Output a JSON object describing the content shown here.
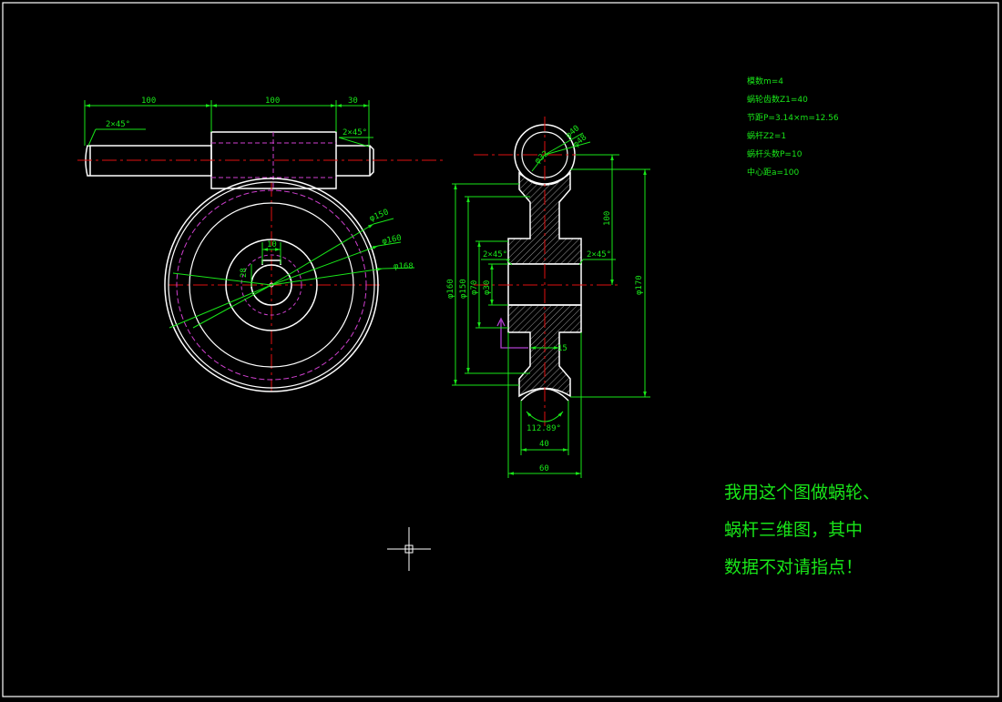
{
  "drawing": {
    "colors": {
      "background": "#000000",
      "outline": "#ffffff",
      "dimension": "#19e619",
      "centerline": "#e01010",
      "hidden": "#d040d0"
    },
    "worm": {
      "dim_left": "100",
      "dim_mid": "100",
      "dim_right": "30",
      "chamfer_left": "2×45°",
      "chamfer_right": "2×45°"
    },
    "wheel_front": {
      "dia_1": "φ150",
      "dia_2": "φ160",
      "dia_3": "φ168",
      "key_w": "10",
      "key_h": "28"
    },
    "wheel_side": {
      "top_d1": "φ40",
      "top_d2": "φ48",
      "top_d3": "φ32",
      "center_dist": "100",
      "dia_a": "φ160",
      "dia_b": "φ150",
      "dia_c": "φ70",
      "dia_d": "φ30",
      "chamfer_l": "2×45°",
      "chamfer_r": "2×45°",
      "overall": "φ170",
      "web": "15",
      "angle": "112.89°",
      "w1": "40",
      "w2": "60"
    },
    "params": [
      "模数m=4",
      "蜗轮齿数Z1=40",
      "节距P=3.14×m=12.56",
      "蜗杆Z2=1",
      "蜗杆头数P=10",
      "中心距a=100"
    ],
    "question": [
      "我用这个图做蜗轮、",
      "蜗杆三维图，其中",
      "数据不对请指点！"
    ]
  }
}
